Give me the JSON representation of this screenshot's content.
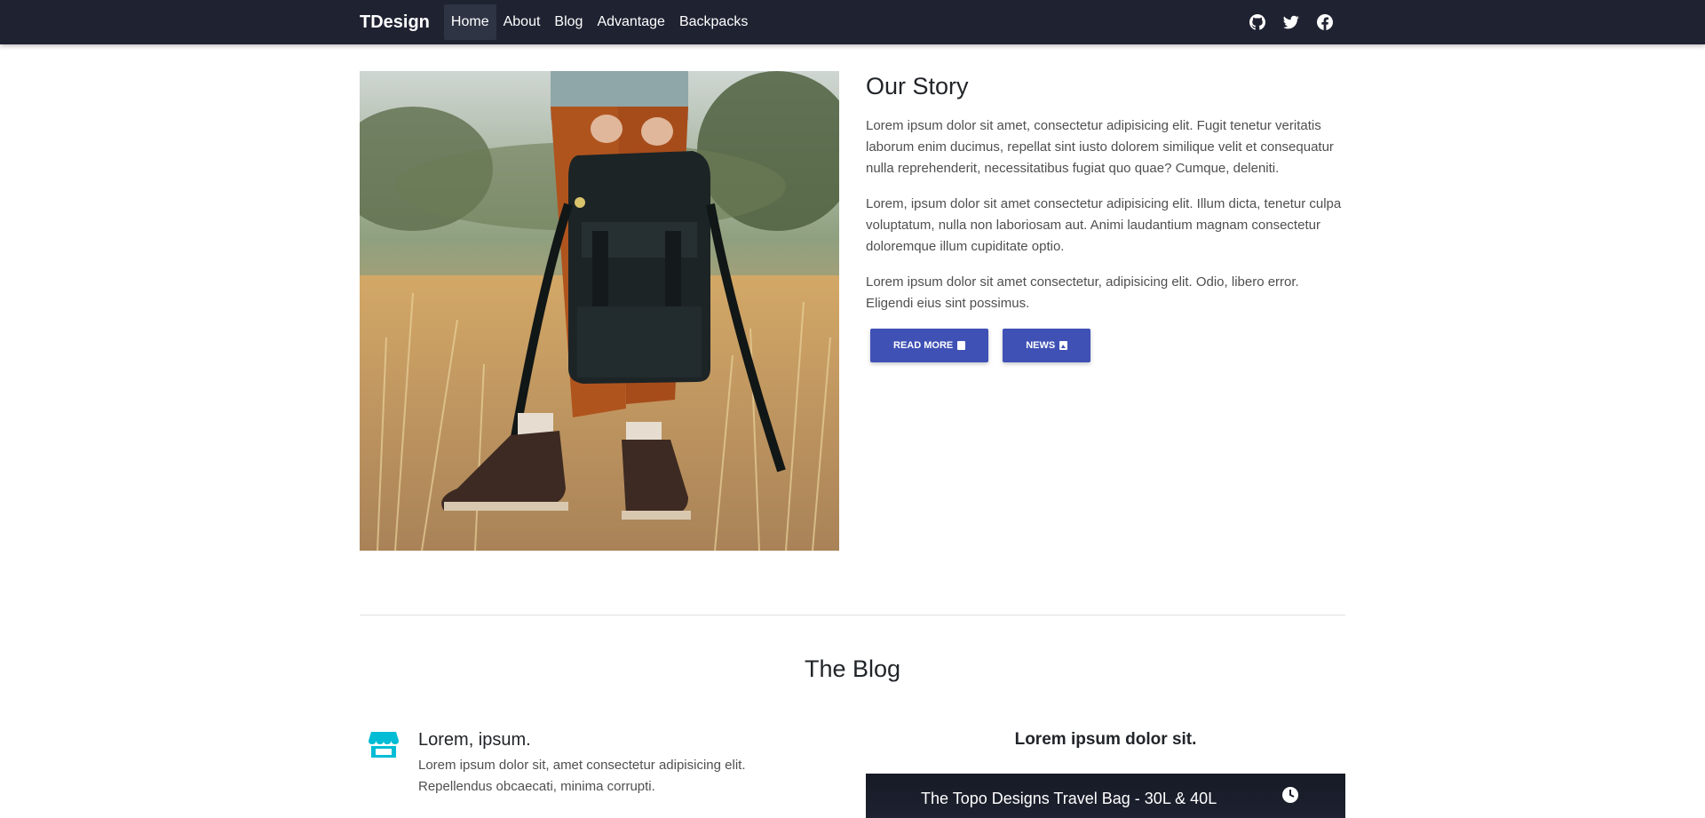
{
  "nav": {
    "brand": "TDesign",
    "links": [
      "Home",
      "About",
      "Blog",
      "Advantage",
      "Backpacks"
    ],
    "active": "Home",
    "icons": [
      "github-icon",
      "twitter-icon",
      "facebook-icon"
    ],
    "background": "#1e2231"
  },
  "story": {
    "image_alt": "Hiker holding a black backpack in a sunny field",
    "title": "Our Story",
    "paragraphs": [
      "Lorem ipsum dolor sit amet, consectetur adipisicing elit. Fugit tenetur veritatis laborum enim ducimus, repellat sint iusto dolorem similique velit et consequatur nulla reprehenderit, necessitatibus fugiat quo quae? Cumque, deleniti.",
      "Lorem, ipsum dolor sit amet consectetur adipisicing elit. Illum dicta, tenetur culpa voluptatum, nulla non laboriosam aut. Animi laudantium magnam consectetur doloremque illum cupiditate optio.",
      "Lorem ipsum dolor sit amet consectetur, adipisicing elit. Odio, libero error. Eligendi eius sint possimus."
    ],
    "buttons": {
      "read_more": "Read more",
      "news": "News"
    },
    "button_color": "#3f51b5"
  },
  "blog": {
    "title": "The Blog",
    "feature": {
      "icon": "store-icon",
      "icon_color": "#00bcd4",
      "title": "Lorem, ipsum.",
      "desc_line1": "Lorem ipsum dolor sit, amet consectetur adipisicing elit.",
      "desc_line2": "Repellendus obcaecati, minima corrupti."
    },
    "video_heading": "Lorem ipsum dolor sit.",
    "video_title": "The Topo Designs Travel Bag - 30L & 40L"
  }
}
